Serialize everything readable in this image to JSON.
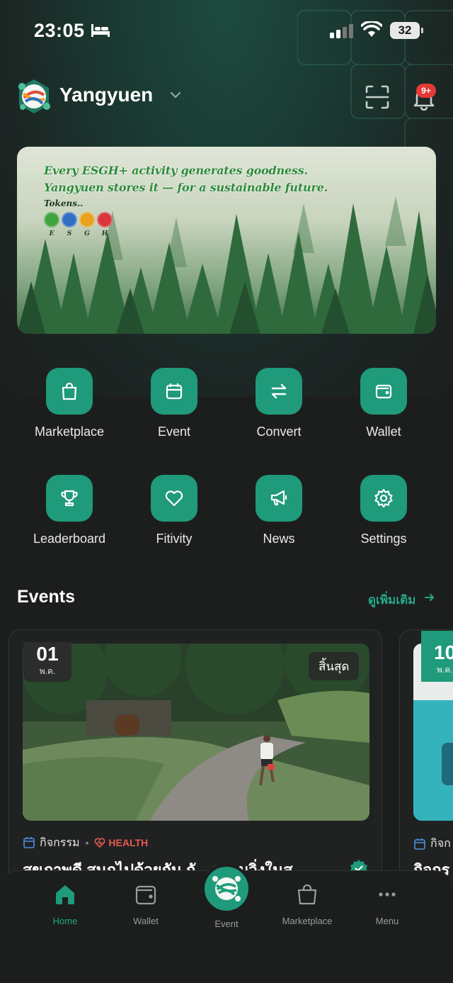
{
  "status_bar": {
    "time": "23:05",
    "battery": "32"
  },
  "header": {
    "app_name": "Yangyuen",
    "notification_badge": "9+"
  },
  "banner": {
    "line1": "Every ESGH+ activity generates goodness.",
    "line2": "Yangyuen stores it — for a sustainable future.",
    "tokens_label": "Tokens..",
    "token_letters": [
      "E",
      "S",
      "G",
      "H"
    ],
    "token_colors": [
      "#3fa33f",
      "#2f6fc2",
      "#e8a21b",
      "#d9373b"
    ]
  },
  "menu": {
    "items": [
      {
        "label": "Marketplace",
        "icon": "shopping-bag-icon"
      },
      {
        "label": "Event",
        "icon": "calendar-icon"
      },
      {
        "label": "Convert",
        "icon": "swap-arrows-icon"
      },
      {
        "label": "Wallet",
        "icon": "wallet-icon"
      },
      {
        "label": "Leaderboard",
        "icon": "trophy-icon"
      },
      {
        "label": "Fitivity",
        "icon": "heart-icon"
      },
      {
        "label": "News",
        "icon": "megaphone-icon"
      },
      {
        "label": "Settings",
        "icon": "gear-icon"
      }
    ]
  },
  "events": {
    "title": "Events",
    "see_more": "ดูเพิ่มเติม",
    "cards": [
      {
        "day": "01",
        "month": "พ.ค.",
        "status": "สิ้นสุด",
        "category": "กิจกรรม",
        "tag": "HEALTH",
        "title": "สุขภาพดี สนุกไปด้วยกัน กั... วรรมวิ่งในส"
      },
      {
        "day": "10",
        "month": "พ.ค.",
        "category": "กิจก",
        "title": "กิจกร"
      }
    ]
  },
  "bottom_nav": {
    "items": [
      {
        "label": "Home",
        "icon": "home-icon",
        "active": true
      },
      {
        "label": "Wallet",
        "icon": "wallet-icon"
      },
      {
        "label": "Event",
        "icon": "event-logo-icon"
      },
      {
        "label": "Marketplace",
        "icon": "shopping-bag-icon"
      },
      {
        "label": "Menu",
        "icon": "more-dots-icon"
      }
    ]
  },
  "colors": {
    "accent": "#1f9a7a",
    "accent_text": "#25a887",
    "badge": "#e53935",
    "health": "#e85a52"
  }
}
